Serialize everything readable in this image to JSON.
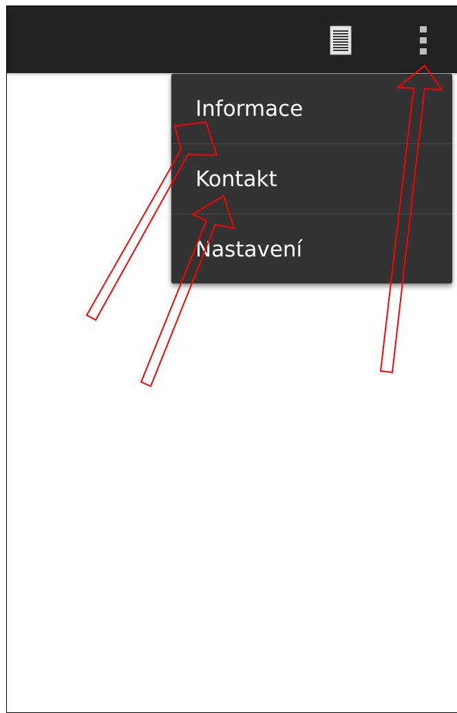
{
  "action_bar": {
    "background": "#222222",
    "icons": [
      "document-icon",
      "overflow-menu-icon"
    ]
  },
  "overflow_menu": {
    "items": [
      {
        "label": "Informace"
      },
      {
        "label": "Kontakt"
      },
      {
        "label": "Nastavení"
      }
    ]
  },
  "annotations": {
    "arrow_color": "#ff0000",
    "arrow_count": 3
  }
}
